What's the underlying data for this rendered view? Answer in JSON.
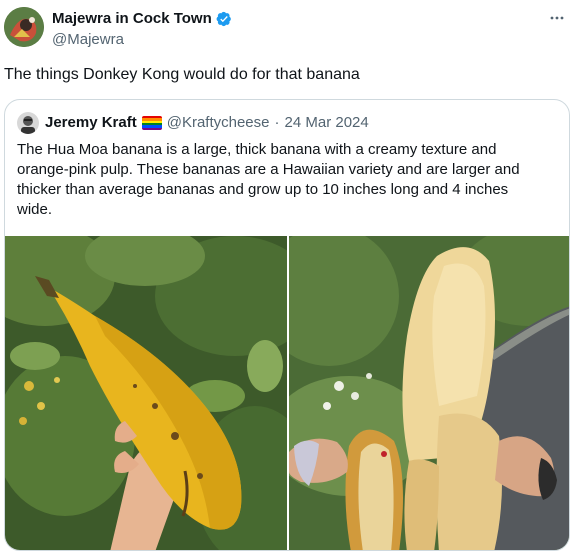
{
  "tweet": {
    "author": {
      "display_name": "Majewra in Cock Town",
      "handle": "@Majewra",
      "verified": true,
      "avatar_icon": "avatar-icon"
    },
    "text": "The things Donkey Kong would do for that banana",
    "menu_icon": "more-icon"
  },
  "quote": {
    "author": {
      "display_name": "Jeremy Kraft",
      "flag_icon": "rainbow-flag-icon",
      "handle": "@Kraftycheese",
      "separator": "·",
      "date": "24 Mar 2024"
    },
    "text": "The Hua Moa banana is a large, thick banana with a creamy texture and orange-pink pulp. These bananas are a Hawaiian variety and are larger and thicker than average bananas and grow up to 10 inches long and 4 inches wide.",
    "media": [
      {
        "kind": "photo",
        "subject": "hand-holding-banana-photo"
      },
      {
        "kind": "photo",
        "subject": "peeled-banana-photo"
      }
    ]
  },
  "colors": {
    "text": "#0f1419",
    "secondary": "#536471",
    "border": "#cfd9de",
    "verified": "#1d9bf0"
  }
}
